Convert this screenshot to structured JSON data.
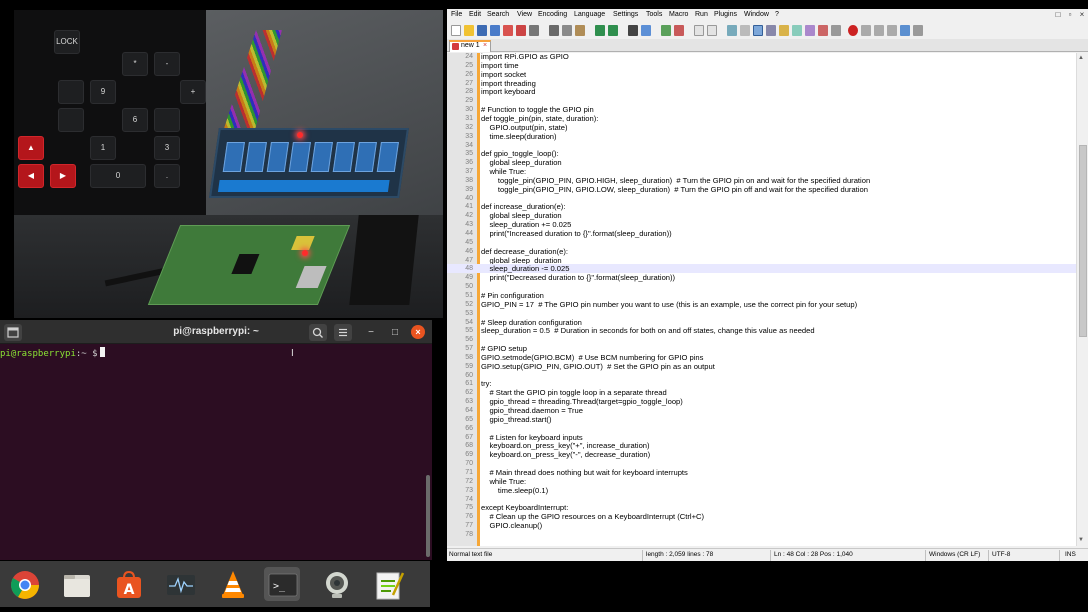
{
  "camera": {
    "keys": [
      "LOCK",
      "*",
      "-",
      "9",
      "+",
      "6",
      "1",
      "3",
      "0",
      "."
    ]
  },
  "terminal": {
    "title": "pi@raspberrypi: ~",
    "prompt_user": "pi@raspberrypi",
    "prompt_path": ":~ $",
    "min_glyph": "−",
    "max_glyph": "□",
    "close_glyph": "×"
  },
  "taskbar": {
    "apps": [
      "chrome-icon",
      "files-icon",
      "software-center-icon",
      "system-monitor-icon",
      "vlc-icon",
      "terminal-icon",
      "webcam-icon",
      "text-editor-icon"
    ],
    "terminal_glyph": ">_"
  },
  "npp": {
    "menu": [
      "File",
      "Edit",
      "Search",
      "View",
      "Encoding",
      "Language",
      "Settings",
      "Tools",
      "Macro",
      "Run",
      "Plugins",
      "Window",
      "?"
    ],
    "window_controls": [
      "□",
      "▫",
      "×"
    ],
    "tab": {
      "label": "new 1",
      "close": "×"
    },
    "current_line": 48,
    "lines": [
      {
        "n": "24",
        "code": "import RPi.GPIO as GPIO"
      },
      {
        "n": "25",
        "code": "import time"
      },
      {
        "n": "26",
        "code": "import socket"
      },
      {
        "n": "27",
        "code": "import threading"
      },
      {
        "n": "28",
        "code": "import keyboard"
      },
      {
        "n": "29",
        "code": ""
      },
      {
        "n": "30",
        "code": "# Function to toggle the GPIO pin"
      },
      {
        "n": "31",
        "code": "def toggle_pin(pin, state, duration):"
      },
      {
        "n": "32",
        "code": "    GPIO.output(pin, state)"
      },
      {
        "n": "33",
        "code": "    time.sleep(duration)"
      },
      {
        "n": "34",
        "code": ""
      },
      {
        "n": "35",
        "code": "def gpio_toggle_loop():"
      },
      {
        "n": "36",
        "code": "    global sleep_duration"
      },
      {
        "n": "37",
        "code": "    while True:"
      },
      {
        "n": "38",
        "code": "        toggle_pin(GPIO_PIN, GPIO.HIGH, sleep_duration)  # Turn the GPIO pin on and wait for the specified duration"
      },
      {
        "n": "39",
        "code": "        toggle_pin(GPIO_PIN, GPIO.LOW, sleep_duration)  # Turn the GPIO pin off and wait for the specified duration"
      },
      {
        "n": "40",
        "code": ""
      },
      {
        "n": "41",
        "code": "def increase_duration(e):"
      },
      {
        "n": "42",
        "code": "    global sleep_duration"
      },
      {
        "n": "43",
        "code": "    sleep_duration += 0.025"
      },
      {
        "n": "44",
        "code": "    print(\"Increased duration to {}\".format(sleep_duration))"
      },
      {
        "n": "45",
        "code": ""
      },
      {
        "n": "46",
        "code": "def decrease_duration(e):"
      },
      {
        "n": "47",
        "code": "    global sleep_duration"
      },
      {
        "n": "48",
        "code": "    sleep_duration -= 0.025"
      },
      {
        "n": "49",
        "code": "    print(\"Decreased duration to {}\".format(sleep_duration))"
      },
      {
        "n": "50",
        "code": ""
      },
      {
        "n": "51",
        "code": "# Pin configuration"
      },
      {
        "n": "52",
        "code": "GPIO_PIN = 17  # The GPIO pin number you want to use (this is an example, use the correct pin for your setup)"
      },
      {
        "n": "53",
        "code": ""
      },
      {
        "n": "54",
        "code": "# Sleep duration configuration"
      },
      {
        "n": "55",
        "code": "sleep_duration = 0.5  # Duration in seconds for both on and off states, change this value as needed"
      },
      {
        "n": "56",
        "code": ""
      },
      {
        "n": "57",
        "code": "# GPIO setup"
      },
      {
        "n": "58",
        "code": "GPIO.setmode(GPIO.BCM)  # Use BCM numbering for GPIO pins"
      },
      {
        "n": "59",
        "code": "GPIO.setup(GPIO_PIN, GPIO.OUT)  # Set the GPIO pin as an output"
      },
      {
        "n": "60",
        "code": ""
      },
      {
        "n": "61",
        "code": "try:"
      },
      {
        "n": "62",
        "code": "    # Start the GPIO pin toggle loop in a separate thread"
      },
      {
        "n": "63",
        "code": "    gpio_thread = threading.Thread(target=gpio_toggle_loop)"
      },
      {
        "n": "64",
        "code": "    gpio_thread.daemon = True"
      },
      {
        "n": "65",
        "code": "    gpio_thread.start()"
      },
      {
        "n": "66",
        "code": ""
      },
      {
        "n": "67",
        "code": "    # Listen for keyboard inputs"
      },
      {
        "n": "68",
        "code": "    keyboard.on_press_key(\"+\", increase_duration)"
      },
      {
        "n": "69",
        "code": "    keyboard.on_press_key(\"-\", decrease_duration)"
      },
      {
        "n": "70",
        "code": ""
      },
      {
        "n": "71",
        "code": "    # Main thread does nothing but wait for keyboard interrupts"
      },
      {
        "n": "72",
        "code": "    while True:"
      },
      {
        "n": "73",
        "code": "        time.sleep(0.1)"
      },
      {
        "n": "74",
        "code": ""
      },
      {
        "n": "75",
        "code": "except KeyboardInterrupt:"
      },
      {
        "n": "76",
        "code": "    # Clean up the GPIO resources on a KeyboardInterrupt (Ctrl+C)"
      },
      {
        "n": "77",
        "code": "    GPIO.cleanup()"
      },
      {
        "n": "78",
        "code": ""
      }
    ],
    "status": {
      "file_type": "Normal text file",
      "length": "length : 2,059    lines : 78",
      "position": "Ln : 48    Col : 28    Pos : 1,040",
      "eol": "Windows (CR LF)",
      "encoding": "UTF-8",
      "mode": "INS"
    }
  },
  "colors": {
    "terminal_bg": "#2c0d22",
    "prompt_green": "#8ae234",
    "fold_margin": "#f6a737",
    "current_line": "#e8e8ff"
  }
}
